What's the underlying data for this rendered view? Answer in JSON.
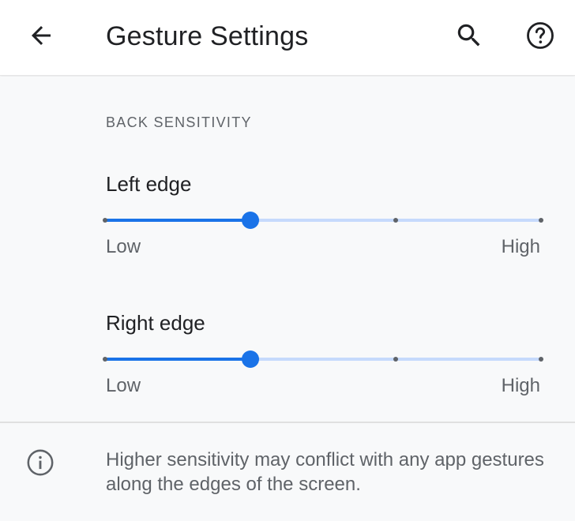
{
  "app_bar": {
    "title": "Gesture Settings",
    "back_icon": "arrow-back-icon",
    "search_icon": "search-icon",
    "help_icon": "help-icon"
  },
  "section": {
    "header": "BACK SENSITIVITY"
  },
  "left_edge": {
    "title": "Left edge",
    "low_label": "Low",
    "high_label": "High",
    "level": 1,
    "max": 3
  },
  "right_edge": {
    "title": "Right edge",
    "low_label": "Low",
    "high_label": "High",
    "level": 1,
    "max": 3
  },
  "footer": {
    "info_icon": "info-icon",
    "text": "Higher sensitivity may conflict with any app gestures along the edges of the screen."
  },
  "colors": {
    "accent": "#1a73e8",
    "track_inactive": "#c6dafc",
    "tick": "#5f6368"
  }
}
